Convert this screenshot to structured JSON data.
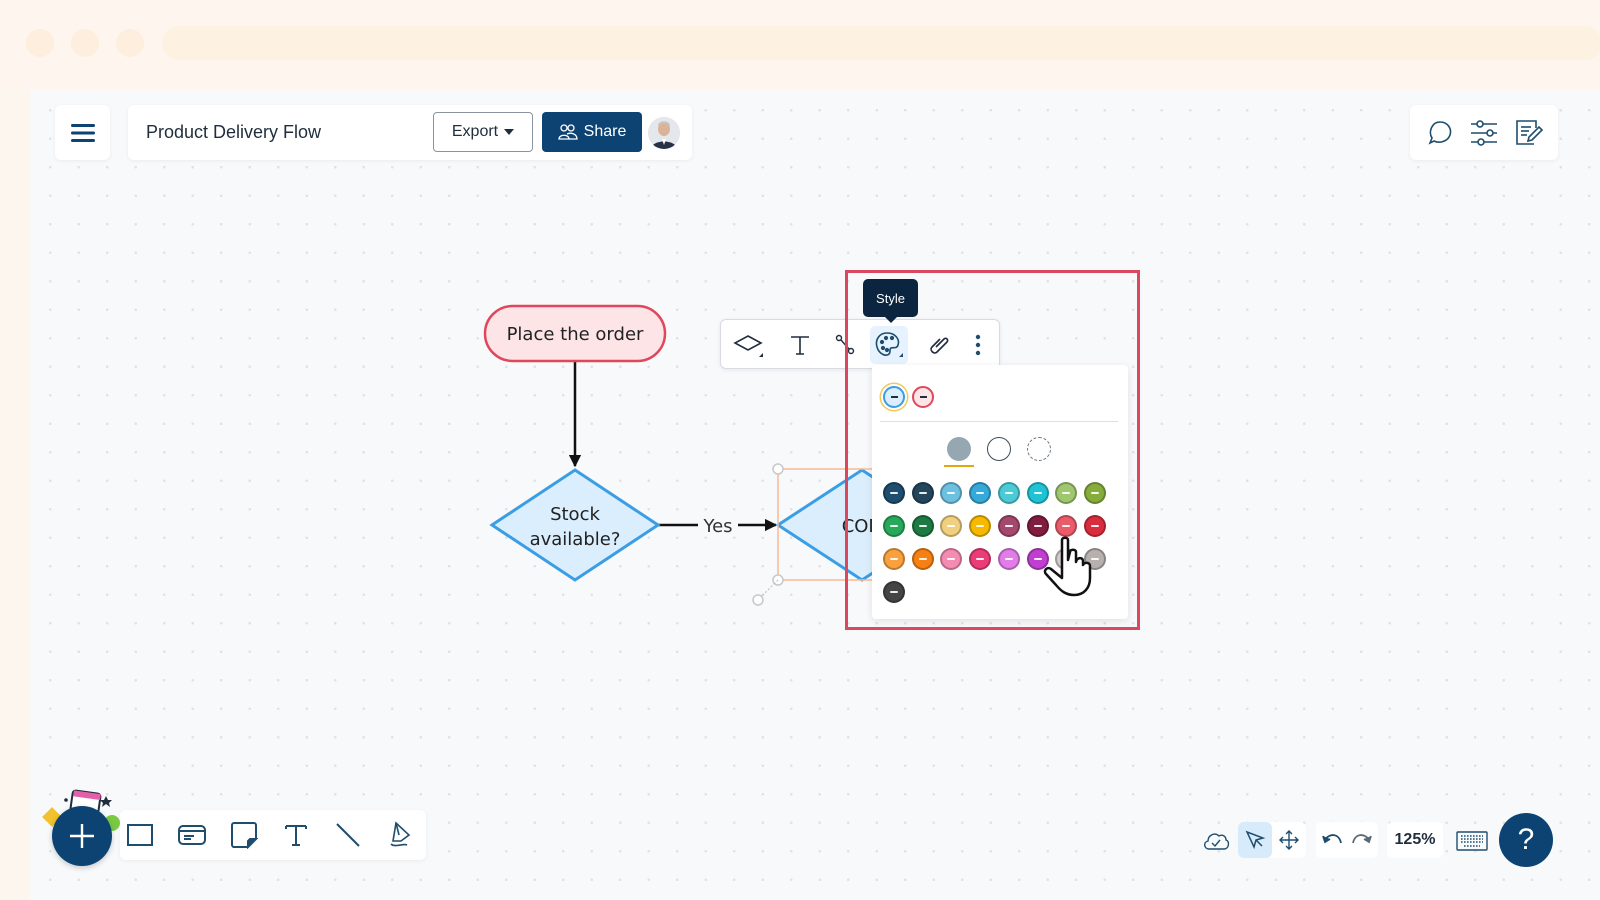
{
  "header": {
    "document_title": "Product Delivery Flow",
    "export_label": "Export",
    "share_label": "Share"
  },
  "icons": {
    "menu": "hamburger-menu-icon",
    "comments": "chat-bubble-icon",
    "settings": "sliders-icon",
    "notes": "edit-document-icon"
  },
  "tooltip": {
    "text": "Style"
  },
  "shape_toolbar": {
    "items": [
      {
        "name": "shape-type",
        "icon": "diamond-icon"
      },
      {
        "name": "text",
        "icon": "text-icon"
      },
      {
        "name": "connector",
        "icon": "connector-icon"
      },
      {
        "name": "style",
        "icon": "palette-icon",
        "active": true
      },
      {
        "name": "link",
        "icon": "link-icon"
      },
      {
        "name": "more",
        "icon": "more-vertical-icon"
      }
    ]
  },
  "style_popup": {
    "preset_swatches": [
      {
        "fill": "#dbeefd",
        "border": "#3b9de3",
        "selected": true
      },
      {
        "fill": "#fde4e6",
        "border": "#e0475c",
        "selected": false
      }
    ],
    "fill_options": [
      "solid",
      "outline",
      "dashed"
    ],
    "selected_fill_option": "solid",
    "colors": [
      [
        "#1e4d6e",
        "#24465c",
        "#6cc1e0",
        "#35a9d8",
        "#4ccbd6",
        "#20c3d6",
        "#9ec76f",
        "#86ad3c"
      ],
      [
        "#27a85a",
        "#1c7a42",
        "#f0cf7f",
        "#f7b900",
        "#a5486e",
        "#811d40",
        "#ea5c6a",
        "#d92d3d"
      ],
      [
        "#f9a03f",
        "#f68013",
        "#f48bb0",
        "#ec3c77",
        "#e17ce8",
        "#c13fd0",
        "#d3cccc",
        "#b7b0ae"
      ],
      [
        "#454545"
      ]
    ]
  },
  "flowchart": {
    "nodes": [
      {
        "id": "start",
        "label": "Place the order",
        "type": "terminal"
      },
      {
        "id": "stock",
        "label_lines": [
          "Stock",
          "available?"
        ],
        "type": "decision"
      },
      {
        "id": "cod",
        "label": "COD",
        "type": "decision",
        "selected": true
      }
    ],
    "edges": [
      {
        "from": "start",
        "to": "stock",
        "label": ""
      },
      {
        "from": "stock",
        "to": "cod",
        "label": "Yes"
      }
    ]
  },
  "bottom_toolbar": {
    "tools": [
      "rectangle-icon",
      "card-icon",
      "sticky-note-icon",
      "text-icon",
      "line-icon",
      "pen-icon"
    ]
  },
  "bottom_right": {
    "zoom_level": "125%",
    "help_label": "?"
  }
}
